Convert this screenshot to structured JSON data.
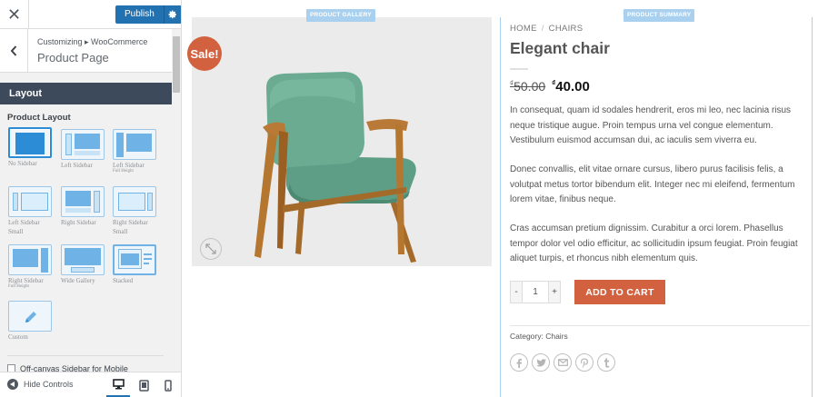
{
  "sidebar": {
    "close_glyph": "✕",
    "publish_label": "Publish",
    "breadcrumb": "Customizing ▸ WooCommerce",
    "section_title": "Product Page",
    "layout_header": "Layout",
    "product_layout_label": "Product Layout",
    "layouts": [
      {
        "label": "No Sidebar",
        "sub": "",
        "selected": true
      },
      {
        "label": "Left Sidebar",
        "sub": ""
      },
      {
        "label": "Left Sidebar",
        "sub": "Full Height"
      },
      {
        "label": "Left Sidebar",
        "sub": "Small"
      },
      {
        "label": "Right Sidebar",
        "sub": ""
      },
      {
        "label": "Right Sidebar",
        "sub": "Small"
      },
      {
        "label": "Right Sidebar",
        "sub": "Full Height"
      },
      {
        "label": "Wide Gallery",
        "sub": ""
      },
      {
        "label": "Stacked",
        "sub": ""
      },
      {
        "label": "Custom",
        "sub": ""
      }
    ],
    "partial_option_label": "Off-canvas Sidebar for Mobile",
    "hide_controls_label": "Hide Controls",
    "accent_color": "#2271b1"
  },
  "preview": {
    "gallery_tag": "PRODUCT GALLERY",
    "summary_tag": "PRODUCT SUMMARY",
    "sale_badge": "Sale!",
    "breadcrumb_home": "HOME",
    "breadcrumb_sep": "/",
    "breadcrumb_category": "CHAIRS",
    "title": "Elegant chair",
    "currency_symbol": "₫",
    "price_old": "50.00",
    "price_new": "40.00",
    "paragraphs": [
      "In consequat, quam id sodales hendrerit, eros mi leo, nec lacinia risus neque tristique augue. Proin tempus urna vel congue elementum. Vestibulum euismod accumsan dui, ac iaculis sem viverra eu.",
      "Donec convallis, elit vitae ornare cursus, libero purus facilisis felis, a volutpat metus tortor bibendum elit. Integer nec mi eleifend, fermentum lorem vitae, finibus neque.",
      "Cras accumsan pretium dignissim. Curabitur a orci lorem. Phasellus tempor dolor vel odio efficitur, ac sollicitudin ipsum feugiat. Proin feugiat aliquet turpis, et rhoncus nibh elementum quis."
    ],
    "qty_minus": "-",
    "qty_value": "1",
    "qty_plus": "+",
    "add_to_cart": "ADD TO CART",
    "category_line": "Category: Chairs",
    "social_icons": [
      "facebook-icon",
      "twitter-icon",
      "email-icon",
      "pinterest-icon",
      "tumblr-icon"
    ],
    "sale_color": "#d2623f",
    "chair_color": "#6aab92"
  }
}
